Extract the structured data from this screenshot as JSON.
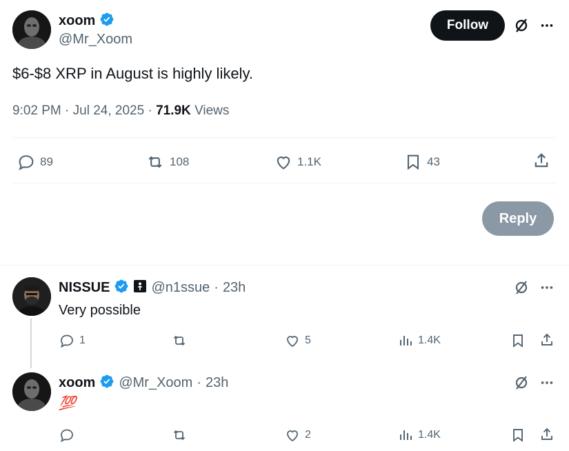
{
  "main_tweet": {
    "author_name": "xoom",
    "author_handle": "@Mr_Xoom",
    "follow_label": "Follow",
    "text": "$6-$8 XRP in August is highly likely.",
    "time": "9:02 PM",
    "date": "Jul 24, 2025",
    "views_count": "71.9K",
    "views_label": "Views",
    "replies": "89",
    "reposts": "108",
    "likes": "1.1K",
    "bookmarks": "43",
    "reply_button_label": "Reply"
  },
  "replies": [
    {
      "author_name": "NISSUE",
      "author_handle": "@n1ssue",
      "time_ago": "23h",
      "text": "Very possible",
      "replies": "1",
      "reposts": "",
      "likes": "5",
      "views": "1.4K"
    },
    {
      "author_name": "xoom",
      "author_handle": "@Mr_Xoom",
      "time_ago": "23h",
      "text": "💯",
      "replies": "",
      "reposts": "",
      "likes": "2",
      "views": "1.4K"
    }
  ],
  "separator": "·",
  "colors": {
    "verified": "#1d9bf0",
    "follow_bg": "#0f1419",
    "reply_button_bg": "#8b98a5",
    "secondary_text": "#536471"
  }
}
